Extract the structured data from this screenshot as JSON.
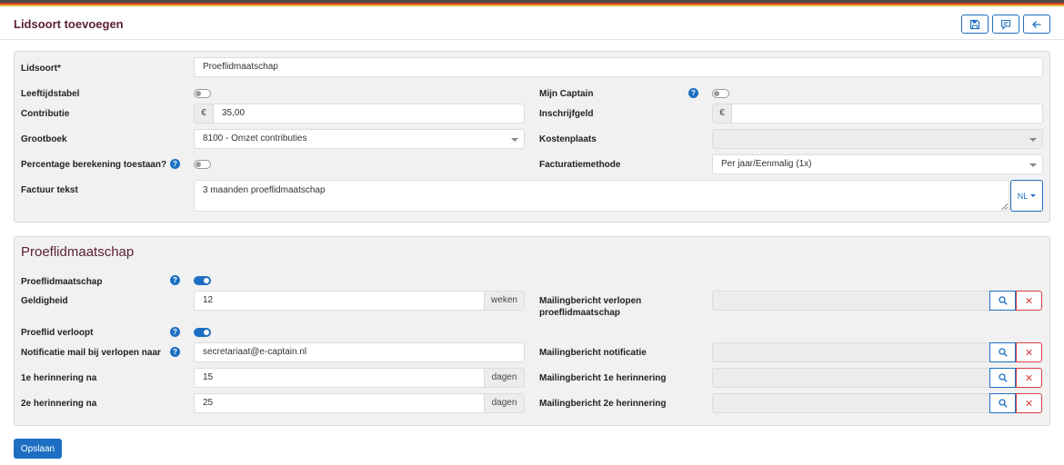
{
  "header": {
    "title": "Lidsoort toevoegen",
    "buttons": {
      "save_icon": "save-icon",
      "comment_icon": "comment-icon",
      "back_icon": "arrow-left-icon"
    }
  },
  "general": {
    "lidsoort": {
      "label": "Lidsoort*",
      "value": "Proeflidmaatschap"
    },
    "leeftijdstabel": {
      "label": "Leeftijdstabel",
      "on": false
    },
    "mijn_captain": {
      "label": "Mijn Captain",
      "on": false,
      "help": "?"
    },
    "contributie": {
      "label": "Contributie",
      "currency": "€",
      "value": "35,00"
    },
    "inschrijfgeld": {
      "label": "Inschrijfgeld",
      "currency": "€",
      "value": ""
    },
    "grootboek": {
      "label": "Grootboek",
      "value": "8100 - Omzet contributies"
    },
    "kostenplaats": {
      "label": "Kostenplaats",
      "value": ""
    },
    "percentage": {
      "label": "Percentage berekening toestaan?",
      "on": false,
      "help": "?"
    },
    "facturatiemethode": {
      "label": "Facturatiemethode",
      "value": "Per jaar/Eenmalig (1x)"
    },
    "factuur_tekst": {
      "label": "Factuur tekst",
      "value": "3 maanden proeflidmaatschap",
      "lang": "NL"
    }
  },
  "proef": {
    "section_title": "Proeflidmaatschap",
    "proeflidmaatschap": {
      "label": "Proeflidmaatschap",
      "on": true,
      "help": "?"
    },
    "geldigheid": {
      "label": "Geldigheid",
      "value": "12",
      "unit": "weken"
    },
    "mailing_verlopen": {
      "label_line1": "Mailingbericht verlopen",
      "label_line2": "proeflidmaatschap",
      "value": ""
    },
    "proeflid_verloopt": {
      "label": "Proeflid verloopt",
      "on": true,
      "help": "?"
    },
    "notificatie_mail": {
      "label": "Notificatie mail bij verlopen naar",
      "value": "secretariaat@e-captain.nl",
      "help": "?"
    },
    "mailing_notificatie": {
      "label": "Mailingbericht notificatie",
      "value": ""
    },
    "herinnering1": {
      "label": "1e herinnering na",
      "value": "15",
      "unit": "dagen"
    },
    "mailing_herinnering1": {
      "label": "Mailingbericht 1e herinnering",
      "value": ""
    },
    "herinnering2": {
      "label": "2e herinnering na",
      "value": "25",
      "unit": "dagen"
    },
    "mailing_herinnering2": {
      "label": "Mailingbericht 2e herinnering",
      "value": ""
    },
    "clear_symbol": "✕"
  },
  "footer": {
    "save_label": "Opslaan"
  },
  "colors": {
    "brand": "#5c2138",
    "primary": "#1c6fc2",
    "danger": "#d84040"
  }
}
